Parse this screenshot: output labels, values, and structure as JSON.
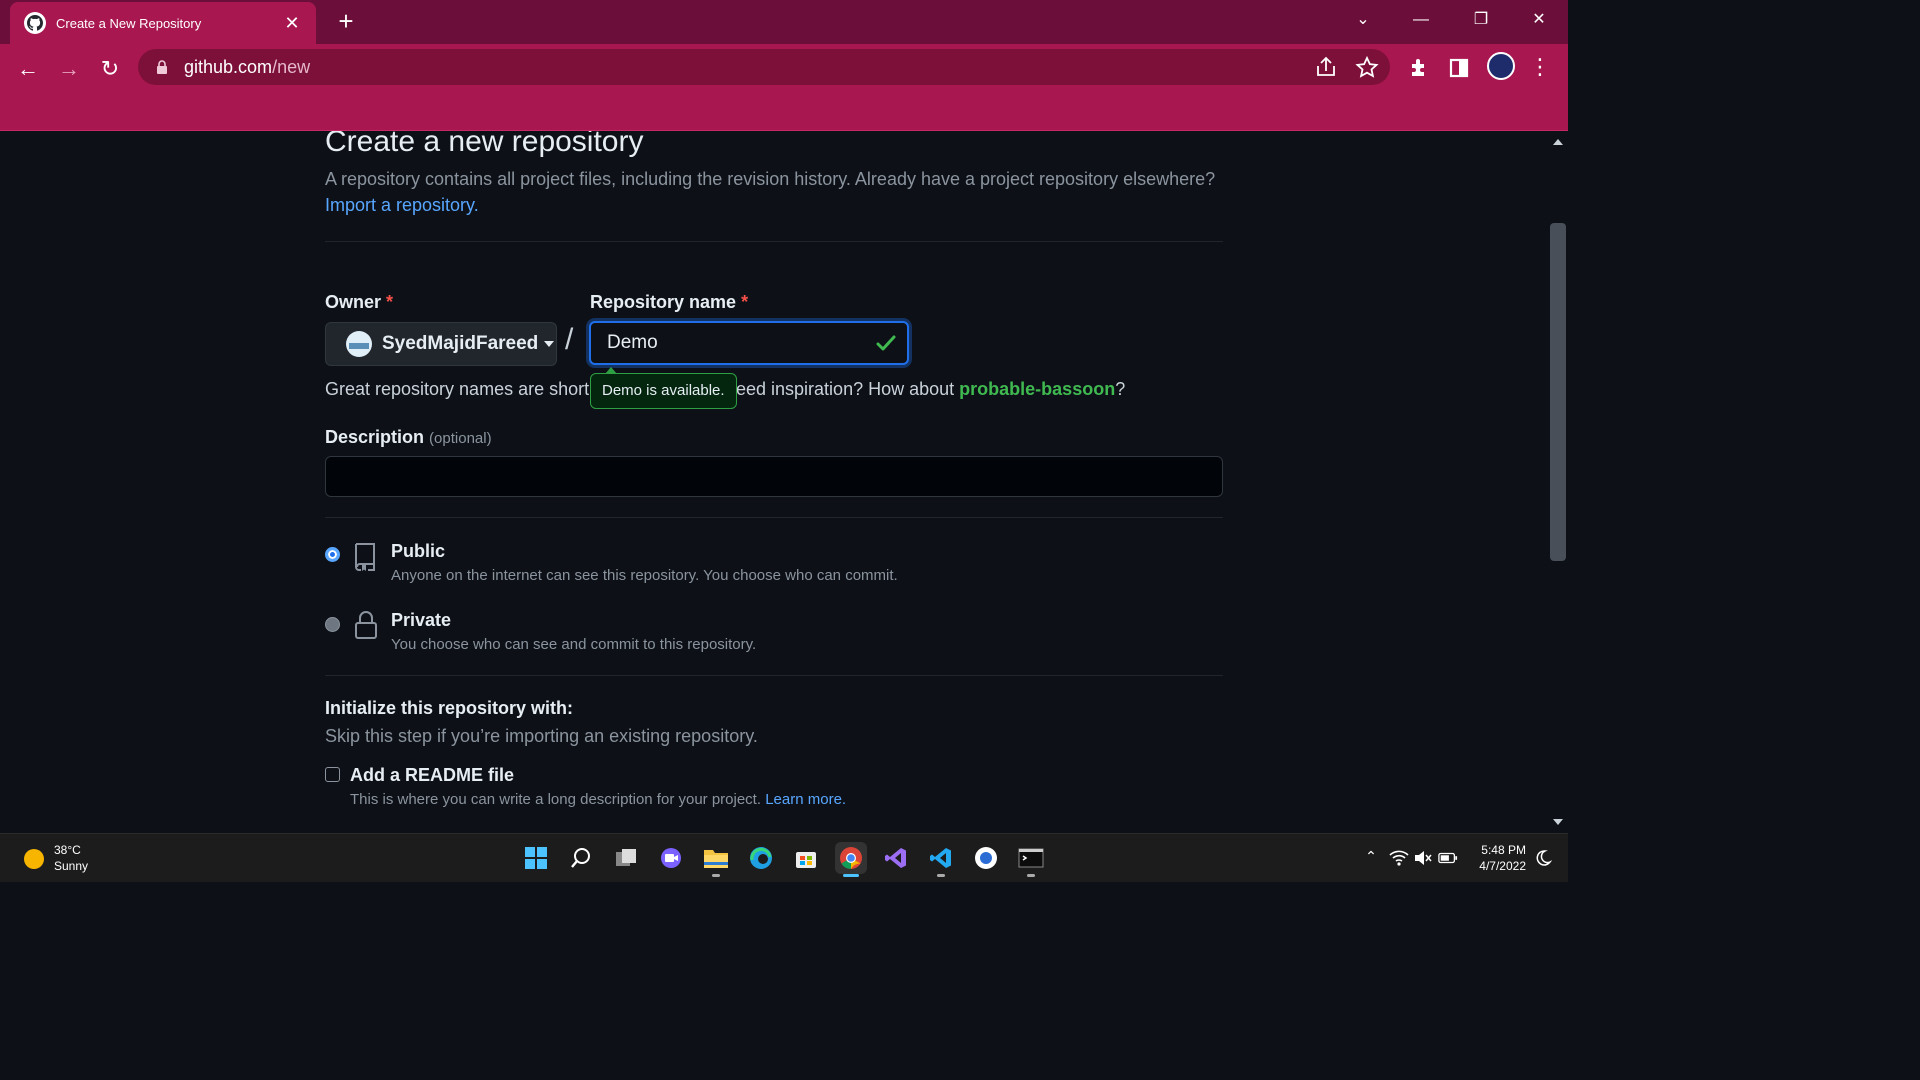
{
  "browser": {
    "tab_title": "Create a New Repository",
    "tab_close": "✕",
    "new_tab": "+",
    "url_host": "github.com",
    "url_path": "/new",
    "win_min": "—",
    "win_restore": "❐",
    "win_close": "✕",
    "tabs_menu": "⌄",
    "menu": "⋮",
    "back": "←",
    "forward": "→",
    "reload": "↻"
  },
  "page": {
    "title": "Create a new repository",
    "lead": "A repository contains all project files, including the revision history. Already have a project repository elsewhere?",
    "import_link": "Import a repository.",
    "owner_label": "Owner",
    "required_mark": "*",
    "owner_name": "SyedMajidFareed",
    "slash": "/",
    "repo_label": "Repository name",
    "repo_value": "Demo",
    "hint_part1": "Great repository names are short",
    "hint_part2": "eed inspiration? How about",
    "suggestion": "probable-bassoon",
    "hint_end": "?",
    "tooltip": "Demo is available.",
    "desc_label": "Description",
    "desc_optional": "(optional)",
    "desc_value": "",
    "visibility": [
      {
        "title": "Public",
        "desc": "Anyone on the internet can see this repository. You choose who can commit.",
        "selected": true
      },
      {
        "title": "Private",
        "desc": "You choose who can see and commit to this repository.",
        "selected": false
      }
    ],
    "init_title": "Initialize this repository with:",
    "init_sub": "Skip this step if you’re importing an existing repository.",
    "readme_title": "Add a README file",
    "readme_desc": "This is where you can write a long description for your project.",
    "learn_more": "Learn more."
  },
  "taskbar": {
    "temp": "38°C",
    "weather": "Sunny",
    "time": "5:48 PM",
    "date": "4/7/2022",
    "apps": [
      "start-icon",
      "search-icon",
      "task-view-icon",
      "chat-icon",
      "file-explorer-icon",
      "edge-icon",
      "store-icon",
      "chrome-icon",
      "visual-studio-icon",
      "vscode-icon",
      "app-icon",
      "terminal-icon"
    ]
  },
  "colors": {
    "tabbar": "#6b0f3a",
    "toolbar": "#a8174f",
    "page_bg": "#0d1117",
    "link": "#58a6ff",
    "success": "#3fb950",
    "focus": "#1f6feb"
  }
}
